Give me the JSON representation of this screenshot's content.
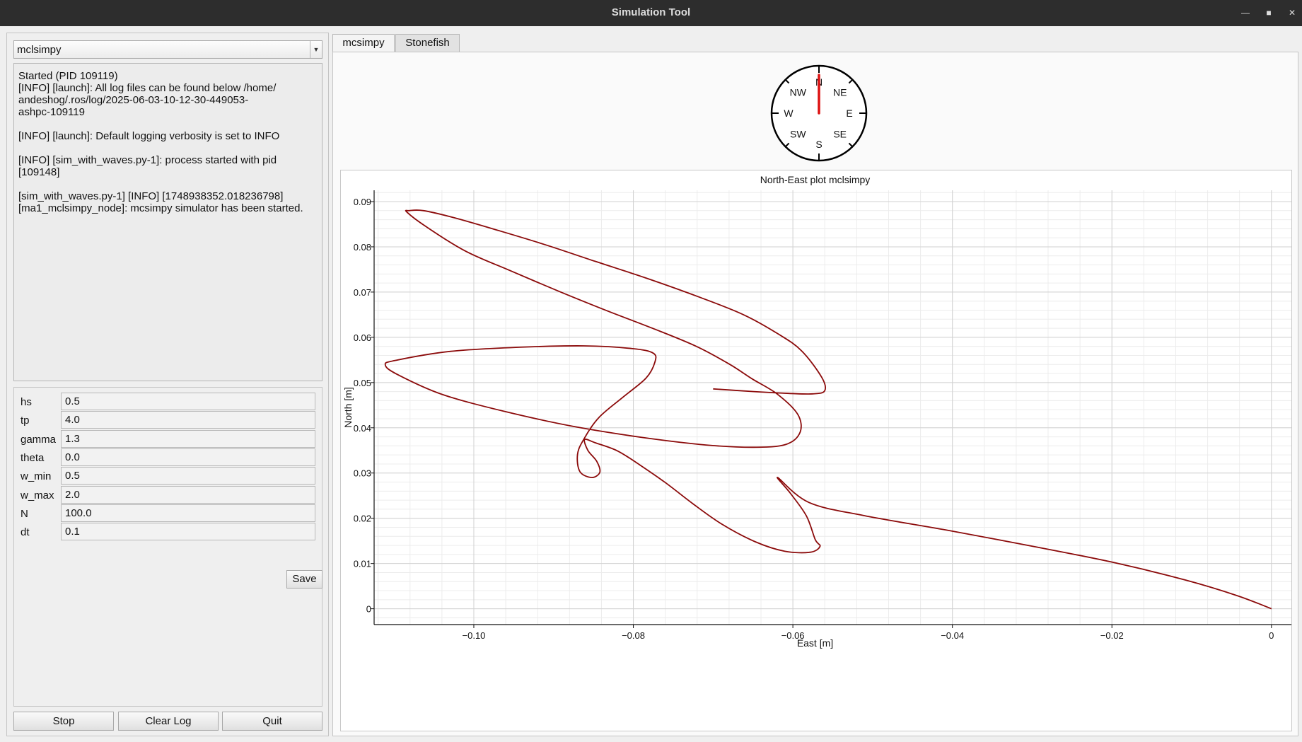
{
  "window": {
    "title": "Simulation Tool",
    "minimize_glyph": "—",
    "maximize_glyph": "■",
    "close_glyph": "✕"
  },
  "selector": {
    "selected": "mclsimpy"
  },
  "log": {
    "lines": [
      "Started (PID 109119)",
      "[INFO] [launch]: All log files can be found below /home/",
      "andeshog/.ros/log/2025-06-03-10-12-30-449053-",
      "ashpc-109119",
      "",
      "[INFO] [launch]: Default logging verbosity is set to INFO",
      "",
      "[INFO] [sim_with_waves.py-1]: process started with pid",
      "[109148]",
      "",
      "[sim_with_waves.py-1] [INFO] [1748938352.018236798]",
      "[ma1_mclsimpy_node]: mcsimpy simulator has been started."
    ]
  },
  "params": [
    {
      "label": "hs",
      "value": "0.5"
    },
    {
      "label": "tp",
      "value": "4.0"
    },
    {
      "label": "gamma",
      "value": "1.3"
    },
    {
      "label": "theta",
      "value": "0.0"
    },
    {
      "label": "w_min",
      "value": "0.5"
    },
    {
      "label": "w_max",
      "value": "2.0"
    },
    {
      "label": "N",
      "value": "100.0"
    },
    {
      "label": "dt",
      "value": "0.1"
    }
  ],
  "buttons": {
    "save": "Save",
    "stop": "Stop",
    "clear_log": "Clear Log",
    "quit": "Quit"
  },
  "tabs": [
    {
      "label": "mcsimpy",
      "active": true
    },
    {
      "label": "Stonefish",
      "active": false
    }
  ],
  "compass": {
    "labels": {
      "N": "N",
      "NE": "NE",
      "E": "E",
      "SE": "SE",
      "S": "S",
      "SW": "SW",
      "W": "W",
      "NW": "NW"
    },
    "heading_deg": 0,
    "needle_color": "#dd1111"
  },
  "chart_data": {
    "type": "line",
    "title": "North-East plot mclsimpy",
    "xlabel": "East [m]",
    "ylabel": "North [m]",
    "xlim": [
      -0.1125,
      0.0025
    ],
    "ylim": [
      -0.0035,
      0.0925
    ],
    "xticks": [
      -0.1,
      -0.08,
      -0.06,
      -0.04,
      -0.02,
      0
    ],
    "xtick_labels": [
      "−0.10",
      "−0.08",
      "−0.06",
      "−0.04",
      "−0.02",
      "0"
    ],
    "yticks": [
      0,
      0.01,
      0.02,
      0.03,
      0.04,
      0.05,
      0.06,
      0.07,
      0.08,
      0.09
    ],
    "ytick_labels": [
      "0",
      "0.01",
      "0.02",
      "0.03",
      "0.04",
      "0.05",
      "0.06",
      "0.07",
      "0.08",
      "0.09"
    ],
    "grid": true,
    "line_color": "#8b0a0a",
    "series": [
      {
        "x": [
          0.0,
          -0.0043,
          -0.0107,
          -0.0197,
          -0.0302,
          -0.0408,
          -0.0511,
          -0.058,
          -0.0619,
          -0.0603,
          -0.0583,
          -0.0572,
          -0.0566,
          -0.0578,
          -0.061,
          -0.0647,
          -0.0689,
          -0.0726,
          -0.076,
          -0.0792,
          -0.082,
          -0.0848,
          -0.0861,
          -0.0857,
          -0.0846,
          -0.0842,
          -0.0852,
          -0.0867,
          -0.087,
          -0.0862,
          -0.0843,
          -0.0812,
          -0.0784,
          -0.0773,
          -0.0775,
          -0.0801,
          -0.0862,
          -0.0943,
          -0.1029,
          -0.1098,
          -0.1111,
          -0.1096,
          -0.104,
          -0.0961,
          -0.0875,
          -0.0786,
          -0.0709,
          -0.0649,
          -0.0609,
          -0.0591,
          -0.0594,
          -0.062,
          -0.0651,
          -0.0679,
          -0.0721,
          -0.0776,
          -0.0832,
          -0.0891,
          -0.0954,
          -0.1011,
          -0.1061,
          -0.1084,
          -0.1081,
          -0.1063,
          -0.1024,
          -0.0969,
          -0.0911,
          -0.0848,
          -0.0784,
          -0.0719,
          -0.0662,
          -0.0618,
          -0.0589,
          -0.0564,
          -0.056,
          -0.0575,
          -0.0605,
          -0.0649,
          -0.07
        ],
        "y": [
          0.0,
          0.0029,
          0.0063,
          0.0102,
          0.0139,
          0.0174,
          0.0206,
          0.0235,
          0.029,
          0.0255,
          0.0205,
          0.0153,
          0.0138,
          0.0125,
          0.0127,
          0.0148,
          0.0187,
          0.0233,
          0.0279,
          0.0318,
          0.0349,
          0.0367,
          0.0374,
          0.035,
          0.0326,
          0.0302,
          0.029,
          0.0303,
          0.0341,
          0.0375,
          0.0423,
          0.0469,
          0.051,
          0.0545,
          0.0565,
          0.0575,
          0.0581,
          0.0578,
          0.0569,
          0.0549,
          0.0539,
          0.0518,
          0.0474,
          0.0436,
          0.0403,
          0.0378,
          0.0362,
          0.0357,
          0.0363,
          0.039,
          0.043,
          0.0475,
          0.0508,
          0.054,
          0.058,
          0.062,
          0.0658,
          0.07,
          0.0747,
          0.0791,
          0.0846,
          0.0877,
          0.088,
          0.088,
          0.0864,
          0.0836,
          0.0805,
          0.0768,
          0.0731,
          0.069,
          0.065,
          0.0607,
          0.057,
          0.0512,
          0.0482,
          0.0475,
          0.0476,
          0.048,
          0.0486
        ]
      }
    ]
  }
}
